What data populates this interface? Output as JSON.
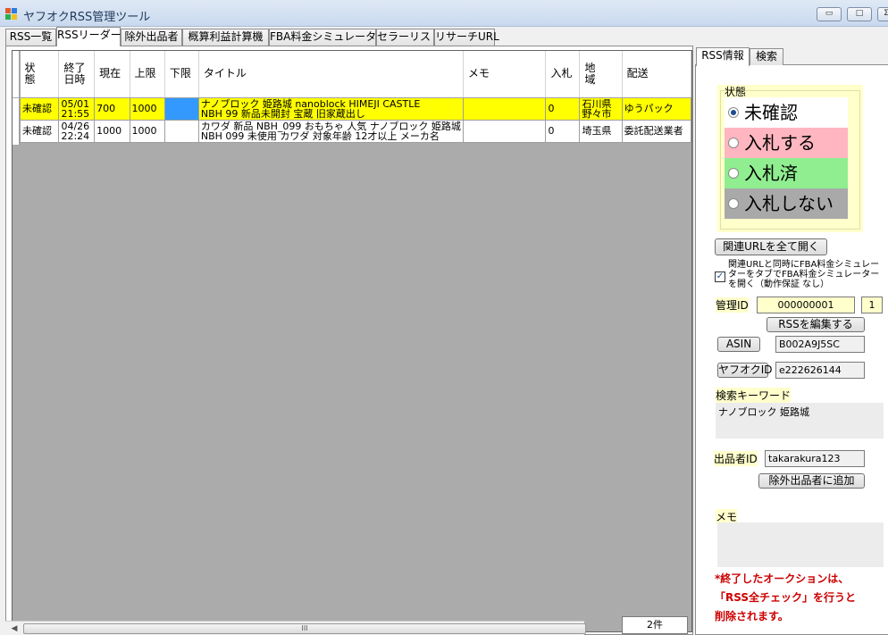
{
  "window": {
    "title": "ヤフオクRSS管理ツール",
    "minimize": "▭",
    "maximize": "□",
    "close": "Σ"
  },
  "tabs": [
    {
      "label": "RSS一覧"
    },
    {
      "label": "RSSリーダー"
    },
    {
      "label": "除外出品者"
    },
    {
      "label": "概算利益計算機"
    },
    {
      "label": "FBA料金シミュレーター"
    },
    {
      "label": "セラーリスト"
    },
    {
      "label": "リサーチURL"
    }
  ],
  "grid": {
    "columns": [
      "状態",
      "終了日時",
      "現在",
      "上限",
      "下限",
      "タイトル",
      "メモ",
      "入札",
      "地域",
      "配送"
    ],
    "rows": [
      {
        "status": "未確認",
        "end_date": "05/01",
        "end_time": "21:55",
        "current": "700",
        "max": "1000",
        "min": "",
        "title_line1": "ナノブロック 姫路城 nanoblock HIMEJI CASTLE",
        "title_line2": "NBH 99 新品未開封 宝蔵 旧家蔵出し",
        "memo": "",
        "bids": "0",
        "region_line1": "石川県",
        "region_line2": "野々市",
        "shipping": "ゆうパック"
      },
      {
        "status": "未確認",
        "end_date": "04/26",
        "end_time": "22:24",
        "current": "1000",
        "max": "1000",
        "min": "",
        "title_line1": "カワダ 新品 NBH_099 おもちゃ 人気 ナノブロック 姫路城",
        "title_line2": "NBH 099 未使用 カワダ 対象年齢 12才以上 メーカ名",
        "memo": "",
        "bids": "0",
        "region_line1": "埼玉県",
        "region_line2": "",
        "shipping": "委託配送業者"
      }
    ],
    "count": "2件",
    "scroll_grip": "III"
  },
  "side": {
    "tabs": [
      {
        "label": "RSS情報"
      },
      {
        "label": "検索"
      }
    ],
    "status_legend": "状態",
    "status_options": [
      {
        "label": "未確認",
        "color": "#ffffff",
        "selected": true
      },
      {
        "label": "入札する",
        "color": "#ffb6c1",
        "selected": false
      },
      {
        "label": "入札済",
        "color": "#90ee90",
        "selected": false
      },
      {
        "label": "入札しない",
        "color": "#a9a9a9",
        "selected": false
      }
    ],
    "open_urls_button": "関連URLを全て開く",
    "checkbox_checked": true,
    "checkbox_note": "関連URLと同時にFBA料金シミュレーターをタブでFBA料金シミュレーターを開く（動作保証 なし）",
    "admin_id_label": "管理ID",
    "admin_id_value": "000000001",
    "admin_id_count": "1",
    "edit_rss_button": "RSSを編集する",
    "asin_button": "ASIN",
    "asin_value": "B002A9J5SC",
    "yafuoku_id_button": "ヤフオクID",
    "yafuoku_id_value": "e222626144",
    "keyword_label": "検索キーワード",
    "keyword_value": "ナノブロック 姫路城",
    "seller_id_label": "出品者ID",
    "seller_id_value": "takarakura123",
    "add_exclude_button": "除外出品者に追加",
    "memo_label": "メモ",
    "memo_value": "",
    "note_lines": [
      "*終了したオークションは、",
      "「RSS全チェック」を行うと",
      "削除されます。"
    ]
  }
}
